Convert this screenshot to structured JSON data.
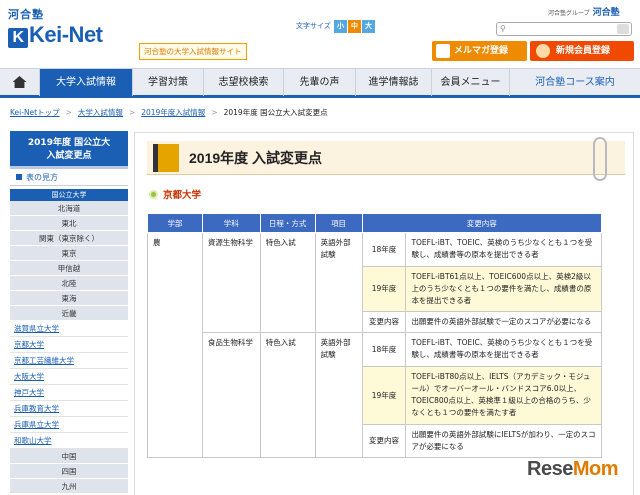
{
  "header": {
    "brand_small": "河合塾",
    "brand": "Kei-Net",
    "tagline": "河合塾の大学入試情報サイト",
    "font_size_label": "文字サイズ",
    "font_sizes": [
      "小",
      "中",
      "大"
    ],
    "group_label": "河合塾グループ",
    "group_brand": "河合塾",
    "mail_button": "メルマガ登録",
    "join_button": "新規会員登録"
  },
  "nav": {
    "items": [
      "大学入試情報",
      "学習対策",
      "志望校検索",
      "先輩の声",
      "進学情報誌",
      "会員メニュー",
      "河合塾コース案内"
    ],
    "active": 0
  },
  "breadcrumb": [
    "Kei-Netトップ",
    "大学入試情報",
    "2019年度入試情報",
    "2019年度 国公立大入試変更点"
  ],
  "sidebar": {
    "title_line1": "2019年度 国公立大",
    "title_line2": "入試変更点",
    "how_to": "表の見方",
    "category": "国公立大学",
    "regions_top": [
      "北海道",
      "東北",
      "関東（東京除く）",
      "東京",
      "甲信越",
      "北陸",
      "東海",
      "近畿"
    ],
    "universities": [
      "滋賀県立大学",
      "京都大学",
      "京都工芸繊維大学",
      "大阪大学",
      "神戸大学",
      "兵庫教育大学",
      "兵庫県立大学",
      "和歌山大学"
    ],
    "regions_bottom": [
      "中国",
      "四国",
      "九州"
    ]
  },
  "page": {
    "title": "2019年度 入試変更点",
    "university": "京都大学"
  },
  "table": {
    "headers": [
      "学部",
      "学科",
      "日程・方式",
      "項目",
      "変更内容"
    ],
    "faculty": "農",
    "dept1": "資源生物科学",
    "dept1_schedule": "特色入試",
    "dept1_item": "英語外部試験",
    "dept1_r1_label": "18年度",
    "dept1_r1_text": "TOEFL-iBT、TOEIC、英検のうち少なくとも１つを受験し、成績書等の原本を提出できる者",
    "dept1_r2_label": "19年度",
    "dept1_r2_text": "TOEFL-iBT61点以上、TOEIC600点以上、英検2級以上のうち少なくとも１つの要件を満たし、成績書の原本を提出できる者",
    "dept1_r3_label": "変更内容",
    "dept1_r3_text": "出願要件の英語外部試験で一定のスコアが必要になる",
    "dept2": "食品生物科学",
    "dept2_schedule": "特色入試",
    "dept2_item": "英語外部試験",
    "dept2_r1_label": "18年度",
    "dept2_r1_text": "TOEFL-iBT、TOEIC、英検のうち少なくとも１つを受験し、成績書等の原本を提出できる者",
    "dept2_r2_label": "19年度",
    "dept2_r2_text": "TOEFL-iBT80点以上、IELTS（アカデミック・モジュール）でオーバーオール・バンドスコア6.0以上、TOEIC800点以上、英検準１級以上の合格のうち、少なくとも１つの要件を満たす者",
    "dept2_r3_label": "変更内容",
    "dept2_r3_text": "出願要件の英語外部試験にIELTSが加わり、一定のスコアが必要になる"
  },
  "watermark": {
    "part1": "Rese",
    "part2": "Mom"
  },
  "colors": {
    "brand_blue": "#1a5fb4",
    "orange": "#ef8b00",
    "red_orange": "#f04a00",
    "highlight": "#fefad7"
  }
}
